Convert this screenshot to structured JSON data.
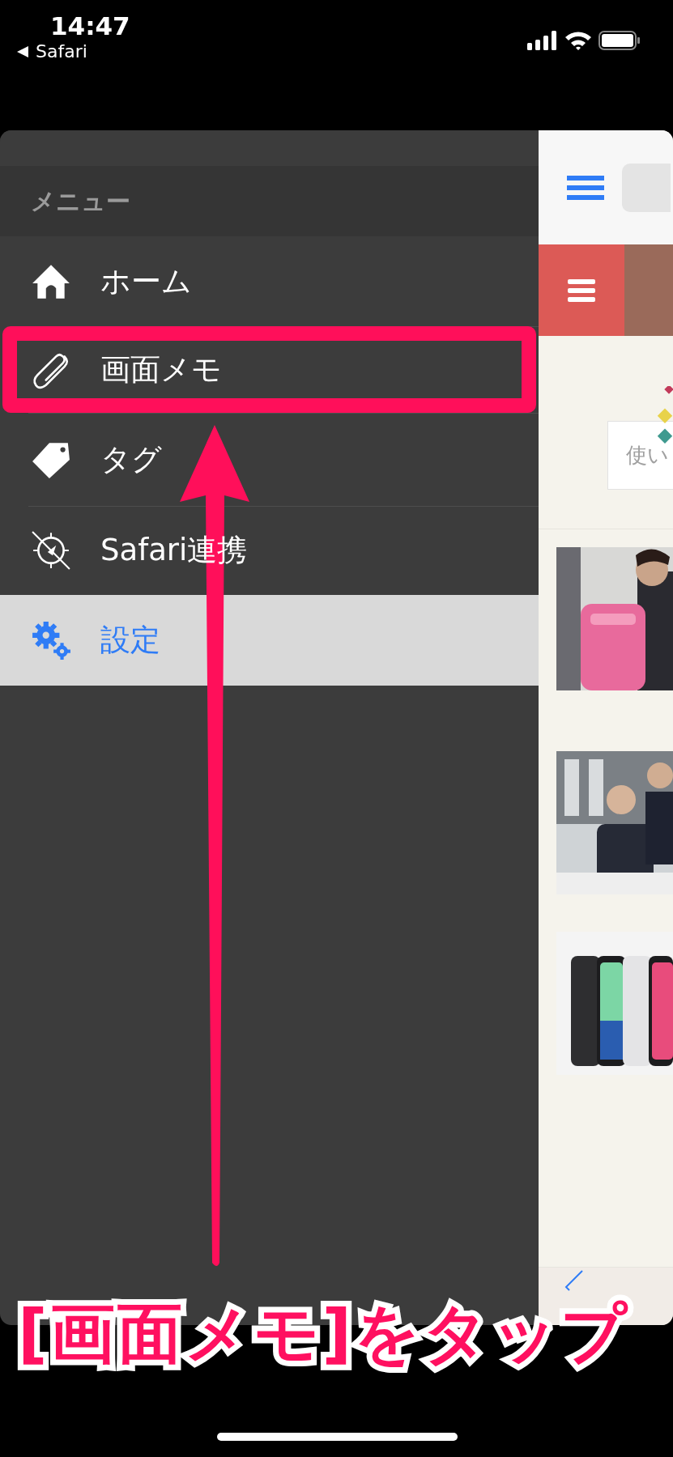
{
  "status_bar": {
    "time": "14:47",
    "back_app": "Safari"
  },
  "menu": {
    "title": "メニュー",
    "items": [
      {
        "label": "ホーム",
        "selected": false
      },
      {
        "label": "画面メモ",
        "selected": false
      },
      {
        "label": "タグ",
        "selected": false
      },
      {
        "label": "Safari連携",
        "selected": false
      },
      {
        "label": "設定",
        "selected": true
      }
    ]
  },
  "background_page": {
    "input_placeholder": "使い"
  },
  "annotation": {
    "caption": "[画面メモ]をタップ"
  }
}
